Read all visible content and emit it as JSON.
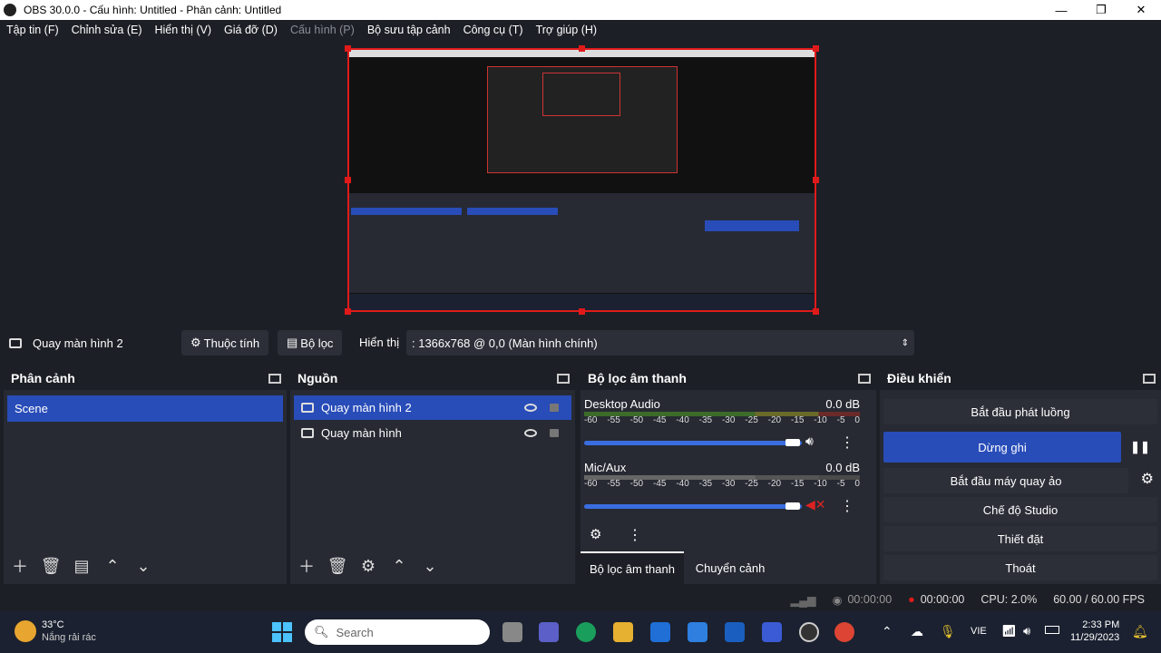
{
  "window": {
    "title": "OBS 30.0.0 - Cấu hình: Untitled - Phân cảnh: Untitled",
    "controls": {
      "minimize": "—",
      "maximize": "❐",
      "close": "✕"
    }
  },
  "menu": [
    {
      "label": "Tập tin (F)",
      "enabled": true
    },
    {
      "label": "Chỉnh sửa (E)",
      "enabled": true
    },
    {
      "label": "Hiển thị (V)",
      "enabled": true
    },
    {
      "label": "Giá đỡ (D)",
      "enabled": true
    },
    {
      "label": "Cấu hình (P)",
      "enabled": false
    },
    {
      "label": "Bộ sưu tập cảnh",
      "enabled": true
    },
    {
      "label": "Công cụ (T)",
      "enabled": true
    },
    {
      "label": "Trợ giúp (H)",
      "enabled": true
    }
  ],
  "source_bar": {
    "selected_source": "Quay màn hình 2",
    "properties_label": "Thuộc tính",
    "filters_label": "Bộ lọc",
    "display_label": "Hiển thị",
    "display_value": ": 1366x768 @ 0,0 (Màn hình chính)"
  },
  "scenes": {
    "title": "Phân cảnh",
    "items": [
      "Scene"
    ]
  },
  "sources": {
    "title": "Nguồn",
    "items": [
      "Quay màn hình 2",
      "Quay màn hình"
    ]
  },
  "mixer": {
    "title": "Bộ lọc âm thanh",
    "ticks": [
      "-60",
      "-55",
      "-50",
      "-45",
      "-40",
      "-35",
      "-30",
      "-25",
      "-20",
      "-15",
      "-10",
      "-5",
      "0"
    ],
    "channels": [
      {
        "name": "Desktop Audio",
        "db": "0.0 dB",
        "muted": false
      },
      {
        "name": "Mic/Aux",
        "db": "0.0 dB",
        "muted": true
      }
    ],
    "tabs": [
      "Bộ lọc âm thanh",
      "Chuyển cảnh"
    ]
  },
  "controls": {
    "title": "Điều khiển",
    "start_stream": "Bắt đầu phát luồng",
    "stop_record": "Dừng ghi",
    "virtual_cam": "Bắt đầu máy quay ảo",
    "studio_mode": "Chế độ Studio",
    "settings": "Thiết đặt",
    "exit": "Thoát"
  },
  "status": {
    "stream_time": "00:00:00",
    "record_time": "00:00:00",
    "cpu": "CPU: 2.0%",
    "fps": "60.00 / 60.00 FPS"
  },
  "taskbar": {
    "weather_temp": "33°C",
    "weather_desc": "Nắng rải rác",
    "search_placeholder": "Search",
    "language": "VIE",
    "time": "2:33 PM",
    "date": "11/29/2023"
  },
  "colors": {
    "accent": "#284cb8",
    "record_red": "#e01a1a",
    "panel": "#272a33",
    "bg": "#1d1f26"
  }
}
